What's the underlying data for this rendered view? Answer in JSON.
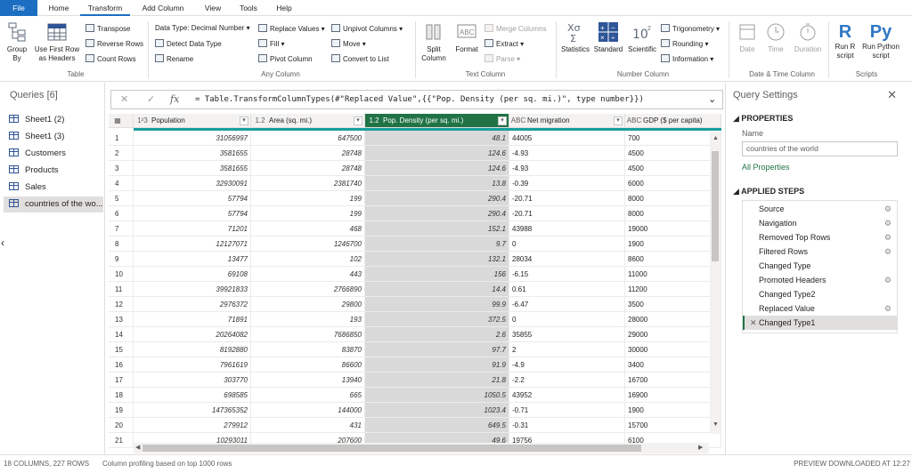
{
  "tabs": [
    "File",
    "Home",
    "Transform",
    "Add Column",
    "View",
    "Tools",
    "Help"
  ],
  "ribbon": {
    "table": {
      "group_by": "Group\nBy",
      "first_row": "Use First Row\nas Headers",
      "transpose": "Transpose",
      "reverse_rows": "Reverse Rows",
      "count_rows": "Count Rows",
      "label": "Table"
    },
    "any_column": {
      "data_type": "Data Type: Decimal Number",
      "detect": "Detect Data Type",
      "rename": "Rename",
      "replace": "Replace Values",
      "fill": "Fill",
      "pivot": "Pivot Column",
      "unpivot": "Unpivot Columns",
      "move": "Move",
      "convert": "Convert to List",
      "label": "Any Column"
    },
    "text_column": {
      "split": "Split\nColumn",
      "format": "Format",
      "merge": "Merge Columns",
      "extract": "Extract",
      "parse": "Parse",
      "label": "Text Column"
    },
    "number_column": {
      "statistics": "Statistics",
      "standard": "Standard",
      "scientific": "Scientific",
      "trig": "Trigonometry",
      "rounding": "Rounding",
      "information": "Information",
      "label": "Number Column"
    },
    "datetime": {
      "date": "Date",
      "time": "Time",
      "duration": "Duration",
      "label": "Date & Time Column"
    },
    "scripts": {
      "r": "Run R\nscript",
      "python": "Run Python\nscript",
      "label": "Scripts"
    }
  },
  "queries": {
    "title": "Queries [6]",
    "items": [
      "Sheet1 (2)",
      "Sheet1 (3)",
      "Customers",
      "Products",
      "Sales",
      "countries of the wo..."
    ]
  },
  "formula": "= Table.TransformColumnTypes(#\"Replaced Value\",{{\"Pop. Density (per sq. mi.)\", type number}})",
  "columns": [
    {
      "type": "1²3",
      "name": "Population"
    },
    {
      "type": "1.2",
      "name": "Area (sq. mi.)"
    },
    {
      "type": "1.2",
      "name": "Pop. Density (per sq. mi.)"
    },
    {
      "type": "ABC",
      "name": "Net migration"
    },
    {
      "type": "ABC",
      "name": "GDP ($ per capita)"
    }
  ],
  "rows": [
    [
      "1",
      "31056997",
      "647500",
      "48.1",
      "44005",
      "700"
    ],
    [
      "2",
      "3581655",
      "28748",
      "124.6",
      "-4.93",
      "4500"
    ],
    [
      "3",
      "3581655",
      "28748",
      "124.6",
      "-4.93",
      "4500"
    ],
    [
      "4",
      "32930091",
      "2381740",
      "13.8",
      "-0.39",
      "6000"
    ],
    [
      "5",
      "57794",
      "199",
      "290.4",
      "-20.71",
      "8000"
    ],
    [
      "6",
      "57794",
      "199",
      "290.4",
      "-20.71",
      "8000"
    ],
    [
      "7",
      "71201",
      "468",
      "152.1",
      "43988",
      "19000"
    ],
    [
      "8",
      "12127071",
      "1246700",
      "9.7",
      "0",
      "1900"
    ],
    [
      "9",
      "13477",
      "102",
      "132.1",
      "28034",
      "8600"
    ],
    [
      "10",
      "69108",
      "443",
      "156",
      "-6.15",
      "11000"
    ],
    [
      "11",
      "39921833",
      "2766890",
      "14.4",
      "0.61",
      "11200"
    ],
    [
      "12",
      "2976372",
      "29800",
      "99.9",
      "-6.47",
      "3500"
    ],
    [
      "13",
      "71891",
      "193",
      "372.5",
      "0",
      "28000"
    ],
    [
      "14",
      "20264082",
      "7686850",
      "2.6",
      "35855",
      "29000"
    ],
    [
      "15",
      "8192880",
      "83870",
      "97.7",
      "2",
      "30000"
    ],
    [
      "16",
      "7961619",
      "86600",
      "91.9",
      "-4.9",
      "3400"
    ],
    [
      "17",
      "303770",
      "13940",
      "21.8",
      "-2.2",
      "16700"
    ],
    [
      "18",
      "698585",
      "665",
      "1050.5",
      "43952",
      "16900"
    ],
    [
      "19",
      "147365352",
      "144000",
      "1023.4",
      "-0.71",
      "1900"
    ],
    [
      "20",
      "279912",
      "431",
      "649.5",
      "-0.31",
      "15700"
    ],
    [
      "21",
      "10293011",
      "207600",
      "49.6",
      "19756",
      "6100"
    ]
  ],
  "settings": {
    "title": "Query Settings",
    "properties": "PROPERTIES",
    "name_label": "Name",
    "name_value": "countries of the world",
    "all_properties": "All Properties",
    "applied_steps": "APPLIED STEPS",
    "steps": [
      {
        "label": "Source",
        "gear": true
      },
      {
        "label": "Navigation",
        "gear": true
      },
      {
        "label": "Removed Top Rows",
        "gear": true
      },
      {
        "label": "Filtered Rows",
        "gear": true
      },
      {
        "label": "Changed Type",
        "gear": false
      },
      {
        "label": "Promoted Headers",
        "gear": true
      },
      {
        "label": "Changed Type2",
        "gear": false
      },
      {
        "label": "Replaced Value",
        "gear": true
      },
      {
        "label": "Changed Type1",
        "gear": false
      }
    ]
  },
  "status": {
    "columns_rows": "18 COLUMNS, 227 ROWS",
    "profiling": "Column profiling based on top 1000 rows",
    "preview": "PREVIEW DOWNLOADED AT 12:27"
  }
}
